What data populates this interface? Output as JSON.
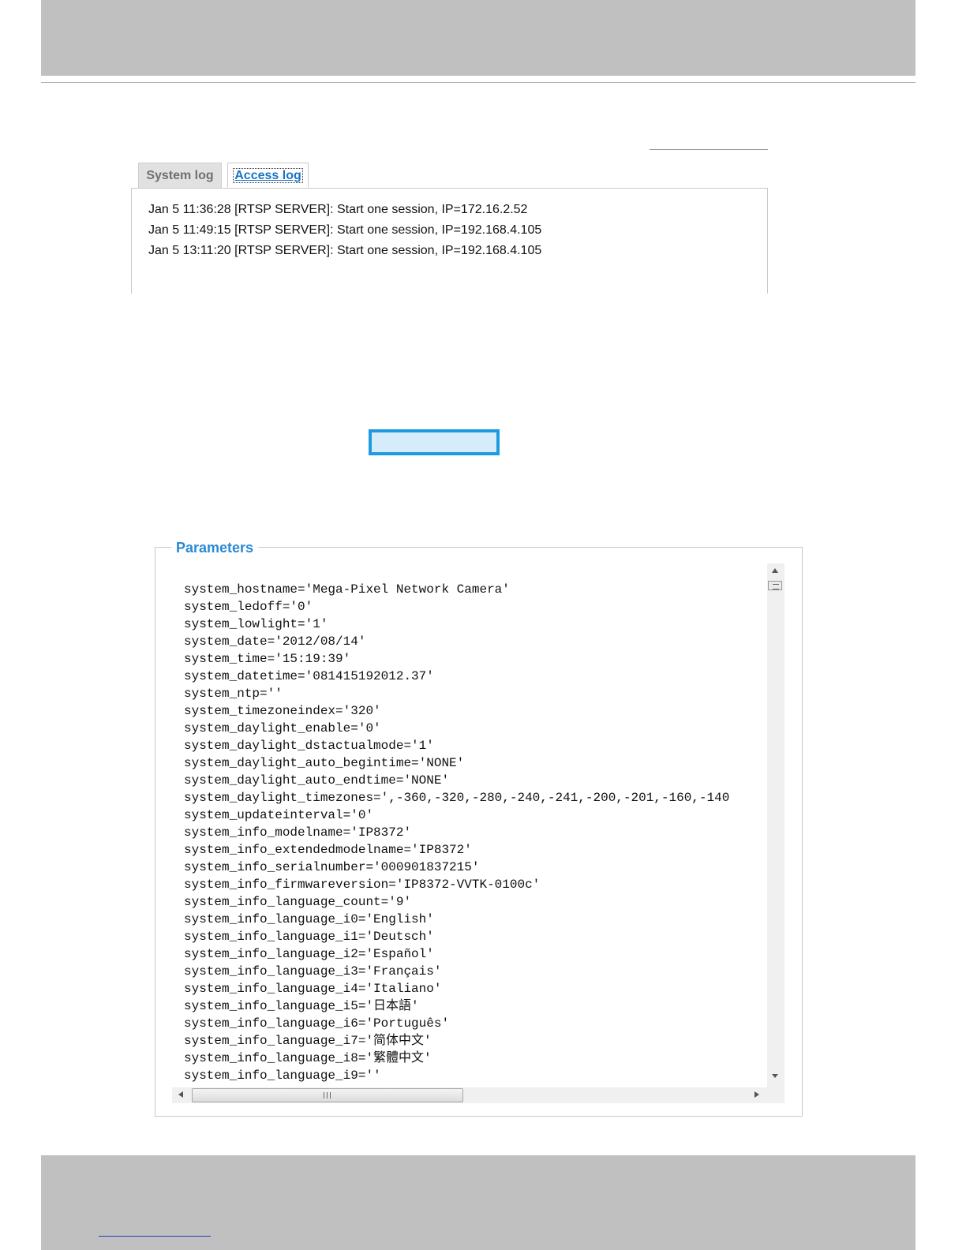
{
  "tabs": {
    "system_log": "System log",
    "access_log": "Access log"
  },
  "access_log_entries": [
    "Jan 5 11:36:28 [RTSP SERVER]: Start one session, IP=172.16.2.52",
    "Jan 5 11:49:15 [RTSP SERVER]: Start one session, IP=192.168.4.105",
    "Jan 5 13:11:20 [RTSP SERVER]: Start one session, IP=192.168.4.105"
  ],
  "parameters": {
    "legend": "Parameters",
    "lines": [
      "system_hostname='Mega-Pixel Network Camera'",
      "system_ledoff='0'",
      "system_lowlight='1'",
      "system_date='2012/08/14'",
      "system_time='15:19:39'",
      "system_datetime='081415192012.37'",
      "system_ntp=''",
      "system_timezoneindex='320'",
      "system_daylight_enable='0'",
      "system_daylight_dstactualmode='1'",
      "system_daylight_auto_begintime='NONE'",
      "system_daylight_auto_endtime='NONE'",
      "system_daylight_timezones=',-360,-320,-280,-240,-241,-200,-201,-160,-140",
      "system_updateinterval='0'",
      "system_info_modelname='IP8372'",
      "system_info_extendedmodelname='IP8372'",
      "system_info_serialnumber='000901837215'",
      "system_info_firmwareversion='IP8372-VVTK-0100c'",
      "system_info_language_count='9'",
      "system_info_language_i0='English'",
      "system_info_language_i1='Deutsch'",
      "system_info_language_i2='Español'",
      "system_info_language_i3='Français'",
      "system_info_language_i4='Italiano'",
      "system_info_language_i5='日本語'",
      "system_info_language_i6='Português'",
      "system_info_language_i7='简体中文'",
      "system_info_language_i8='繁體中文'",
      "system_info_language_i9=''"
    ]
  },
  "colors": {
    "band_gray": "#c0c0c0",
    "link_blue": "#1a73c8",
    "legend_blue": "#2a8ad4",
    "button_border": "#1e9be0",
    "button_fill": "#d6ecfa"
  }
}
